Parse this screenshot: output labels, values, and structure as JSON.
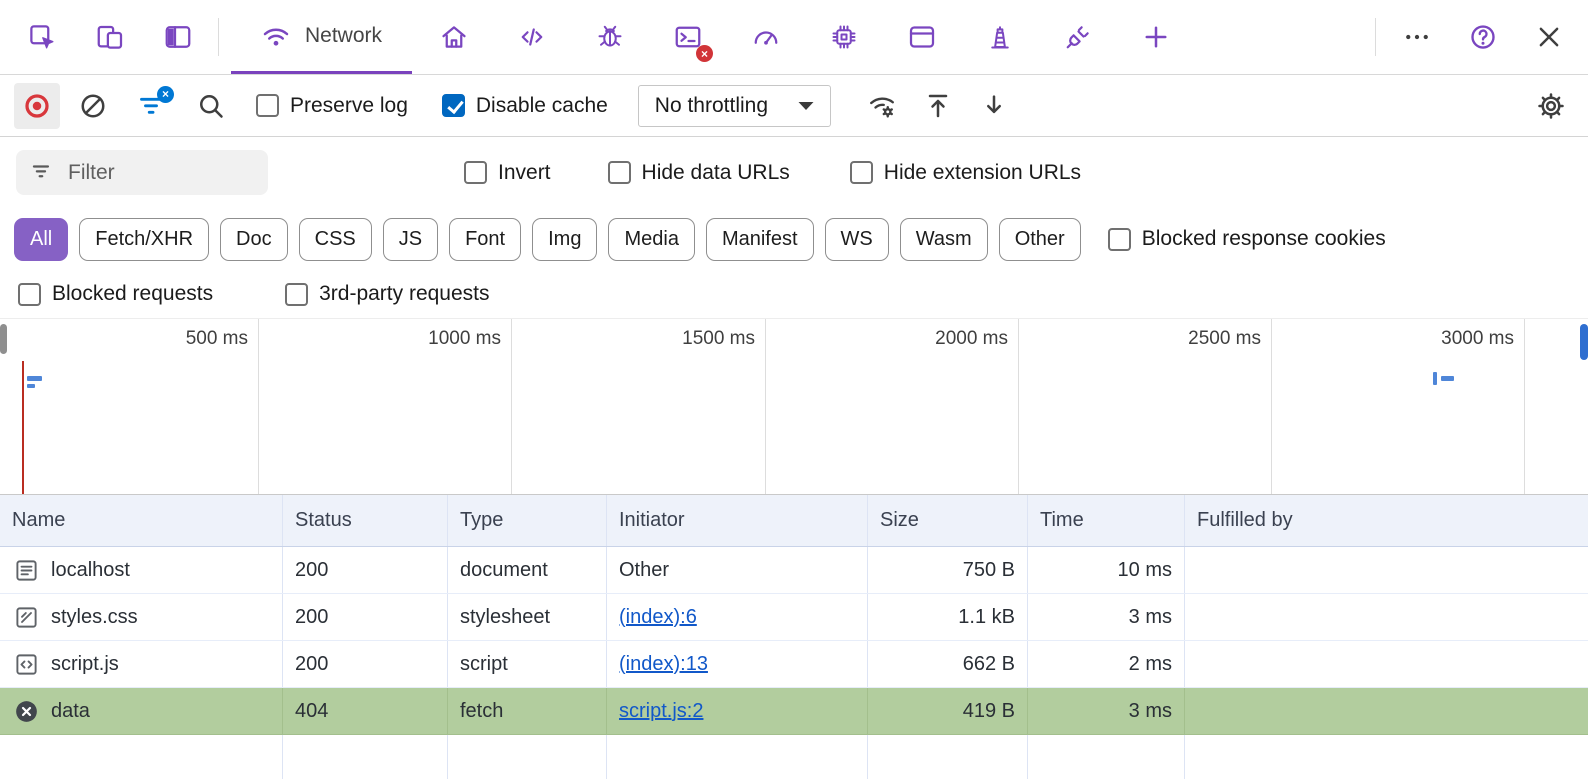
{
  "colors": {
    "accent_purple": "#7a46c0",
    "chip_selected_purple": "#8661c5",
    "checkbox_blue": "#0067c0",
    "record_red": "#d8373c",
    "error_badge_red": "#d13438",
    "filter_badge_blue": "#0078d4",
    "selected_row_green": "#b2cd9e",
    "link_blue": "#1158c9",
    "timeline_marker_red": "#b92d21",
    "timeline_marker_blue": "#4f86d8"
  },
  "tabbar": {
    "icons_left": [
      {
        "name": "inspect-icon"
      },
      {
        "name": "device-emulation-icon"
      },
      {
        "name": "panel-layout-icon"
      }
    ],
    "active_tab": {
      "label": "Network",
      "icon": "wifi-icon"
    },
    "icons_right": [
      {
        "name": "home-icon"
      },
      {
        "name": "sources-icon"
      },
      {
        "name": "debugger-icon"
      },
      {
        "name": "console-icon",
        "badge": "×"
      },
      {
        "name": "performance-icon"
      },
      {
        "name": "memory-icon"
      },
      {
        "name": "application-icon"
      },
      {
        "name": "lighthouse-icon"
      },
      {
        "name": "attach-icon"
      },
      {
        "name": "add-tab-icon"
      }
    ],
    "window_controls": [
      {
        "name": "more-options-icon"
      },
      {
        "name": "help-icon"
      },
      {
        "name": "close-icon"
      }
    ]
  },
  "toolbar": {
    "filter_badge": "×",
    "preserve_log_label": "Preserve log",
    "preserve_log_checked": false,
    "disable_cache_label": "Disable cache",
    "disable_cache_checked": true,
    "throttling_value": "No throttling"
  },
  "filter_row": {
    "filter_placeholder": "Filter",
    "invert_label": "Invert",
    "invert_checked": false,
    "hide_data_urls_label": "Hide data URLs",
    "hide_data_urls_checked": false,
    "hide_extension_urls_label": "Hide extension URLs",
    "hide_extension_urls_checked": false
  },
  "type_chips": {
    "selected": "All",
    "items": [
      "All",
      "Fetch/XHR",
      "Doc",
      "CSS",
      "JS",
      "Font",
      "Img",
      "Media",
      "Manifest",
      "WS",
      "Wasm",
      "Other"
    ],
    "blocked_response_cookies_label": "Blocked response cookies",
    "blocked_response_cookies_checked": false
  },
  "request_filters": {
    "blocked_requests_label": "Blocked requests",
    "blocked_requests_checked": false,
    "third_party_label": "3rd-party requests",
    "third_party_checked": false
  },
  "timeline": {
    "tick_labels": [
      "500 ms",
      "1000 ms",
      "1500 ms",
      "2000 ms",
      "2500 ms",
      "3000 ms"
    ]
  },
  "table": {
    "columns": [
      "Name",
      "Status",
      "Type",
      "Initiator",
      "Size",
      "Time",
      "Fulfilled by"
    ],
    "rows": [
      {
        "icon": "document-icon",
        "name": "localhost",
        "status": "200",
        "type": "document",
        "initiator": "Other",
        "initiator_is_link": false,
        "size": "750 B",
        "time": "10 ms",
        "fulfilled_by": "",
        "selected": false
      },
      {
        "icon": "stylesheet-icon",
        "name": "styles.css",
        "status": "200",
        "type": "stylesheet",
        "initiator": "(index):6",
        "initiator_is_link": true,
        "size": "1.1 kB",
        "time": "3 ms",
        "fulfilled_by": "",
        "selected": false
      },
      {
        "icon": "script-icon",
        "name": "script.js",
        "status": "200",
        "type": "script",
        "initiator": "(index):13",
        "initiator_is_link": true,
        "size": "662 B",
        "time": "2 ms",
        "fulfilled_by": "",
        "selected": false
      },
      {
        "icon": "error-icon",
        "name": "data",
        "status": "404",
        "type": "fetch",
        "initiator": "script.js:2",
        "initiator_is_link": true,
        "size": "419 B",
        "time": "3 ms",
        "fulfilled_by": "",
        "selected": true
      }
    ]
  }
}
